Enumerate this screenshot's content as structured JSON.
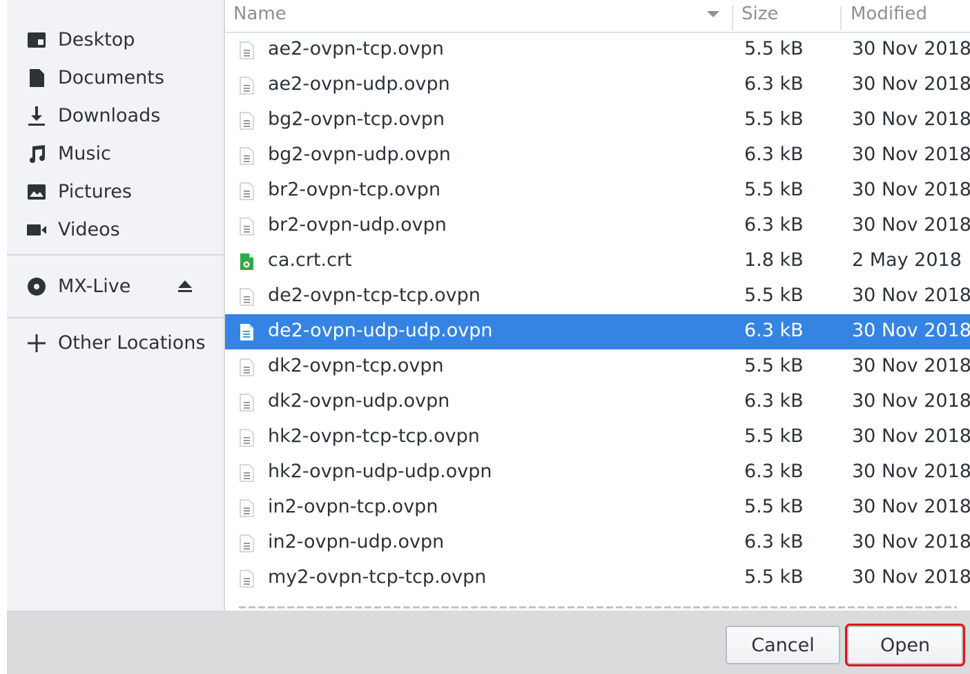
{
  "sidebar": {
    "places": [
      {
        "label": "Desktop",
        "icon": "desktop-icon"
      },
      {
        "label": "Documents",
        "icon": "documents-icon"
      },
      {
        "label": "Downloads",
        "icon": "downloads-icon"
      },
      {
        "label": "Music",
        "icon": "music-icon"
      },
      {
        "label": "Pictures",
        "icon": "pictures-icon"
      },
      {
        "label": "Videos",
        "icon": "videos-icon"
      }
    ],
    "devices": [
      {
        "label": "MX-Live",
        "icon": "disc-icon",
        "action_icon": "eject-icon"
      }
    ],
    "other": [
      {
        "label": "Other Locations",
        "icon": "plus-icon"
      }
    ]
  },
  "columns": {
    "name": "Name",
    "size": "Size",
    "modified": "Modified"
  },
  "files": [
    {
      "name": "ae2-ovpn-tcp.ovpn",
      "size": "5.5 kB",
      "modified": "30 Nov 2018",
      "icon": "text-file-icon",
      "selected": false
    },
    {
      "name": "ae2-ovpn-udp.ovpn",
      "size": "6.3 kB",
      "modified": "30 Nov 2018",
      "icon": "text-file-icon",
      "selected": false
    },
    {
      "name": "bg2-ovpn-tcp.ovpn",
      "size": "5.5 kB",
      "modified": "30 Nov 2018",
      "icon": "text-file-icon",
      "selected": false
    },
    {
      "name": "bg2-ovpn-udp.ovpn",
      "size": "6.3 kB",
      "modified": "30 Nov 2018",
      "icon": "text-file-icon",
      "selected": false
    },
    {
      "name": "br2-ovpn-tcp.ovpn",
      "size": "5.5 kB",
      "modified": "30 Nov 2018",
      "icon": "text-file-icon",
      "selected": false
    },
    {
      "name": "br2-ovpn-udp.ovpn",
      "size": "6.3 kB",
      "modified": "30 Nov 2018",
      "icon": "text-file-icon",
      "selected": false
    },
    {
      "name": "ca.crt.crt",
      "size": "1.8 kB",
      "modified": "2 May 2018",
      "icon": "certificate-file-icon",
      "selected": false
    },
    {
      "name": "de2-ovpn-tcp-tcp.ovpn",
      "size": "5.5 kB",
      "modified": "30 Nov 2018",
      "icon": "text-file-icon",
      "selected": false
    },
    {
      "name": "de2-ovpn-udp-udp.ovpn",
      "size": "6.3 kB",
      "modified": "30 Nov 2018",
      "icon": "text-file-icon",
      "selected": true
    },
    {
      "name": "dk2-ovpn-tcp.ovpn",
      "size": "5.5 kB",
      "modified": "30 Nov 2018",
      "icon": "text-file-icon",
      "selected": false
    },
    {
      "name": "dk2-ovpn-udp.ovpn",
      "size": "6.3 kB",
      "modified": "30 Nov 2018",
      "icon": "text-file-icon",
      "selected": false
    },
    {
      "name": "hk2-ovpn-tcp-tcp.ovpn",
      "size": "5.5 kB",
      "modified": "30 Nov 2018",
      "icon": "text-file-icon",
      "selected": false
    },
    {
      "name": "hk2-ovpn-udp-udp.ovpn",
      "size": "6.3 kB",
      "modified": "30 Nov 2018",
      "icon": "text-file-icon",
      "selected": false
    },
    {
      "name": "in2-ovpn-tcp.ovpn",
      "size": "5.5 kB",
      "modified": "30 Nov 2018",
      "icon": "text-file-icon",
      "selected": false
    },
    {
      "name": "in2-ovpn-udp.ovpn",
      "size": "6.3 kB",
      "modified": "30 Nov 2018",
      "icon": "text-file-icon",
      "selected": false
    },
    {
      "name": "my2-ovpn-tcp-tcp.ovpn",
      "size": "5.5 kB",
      "modified": "30 Nov 2018",
      "icon": "text-file-icon",
      "selected": false
    }
  ],
  "actions": {
    "cancel_label": "Cancel",
    "open_label": "Open"
  },
  "colors": {
    "selection": "#3584e4",
    "highlight_outline": "#e0141b",
    "sidebar_bg": "#f1f3f6",
    "actionbar_bg": "#dadbdd"
  }
}
